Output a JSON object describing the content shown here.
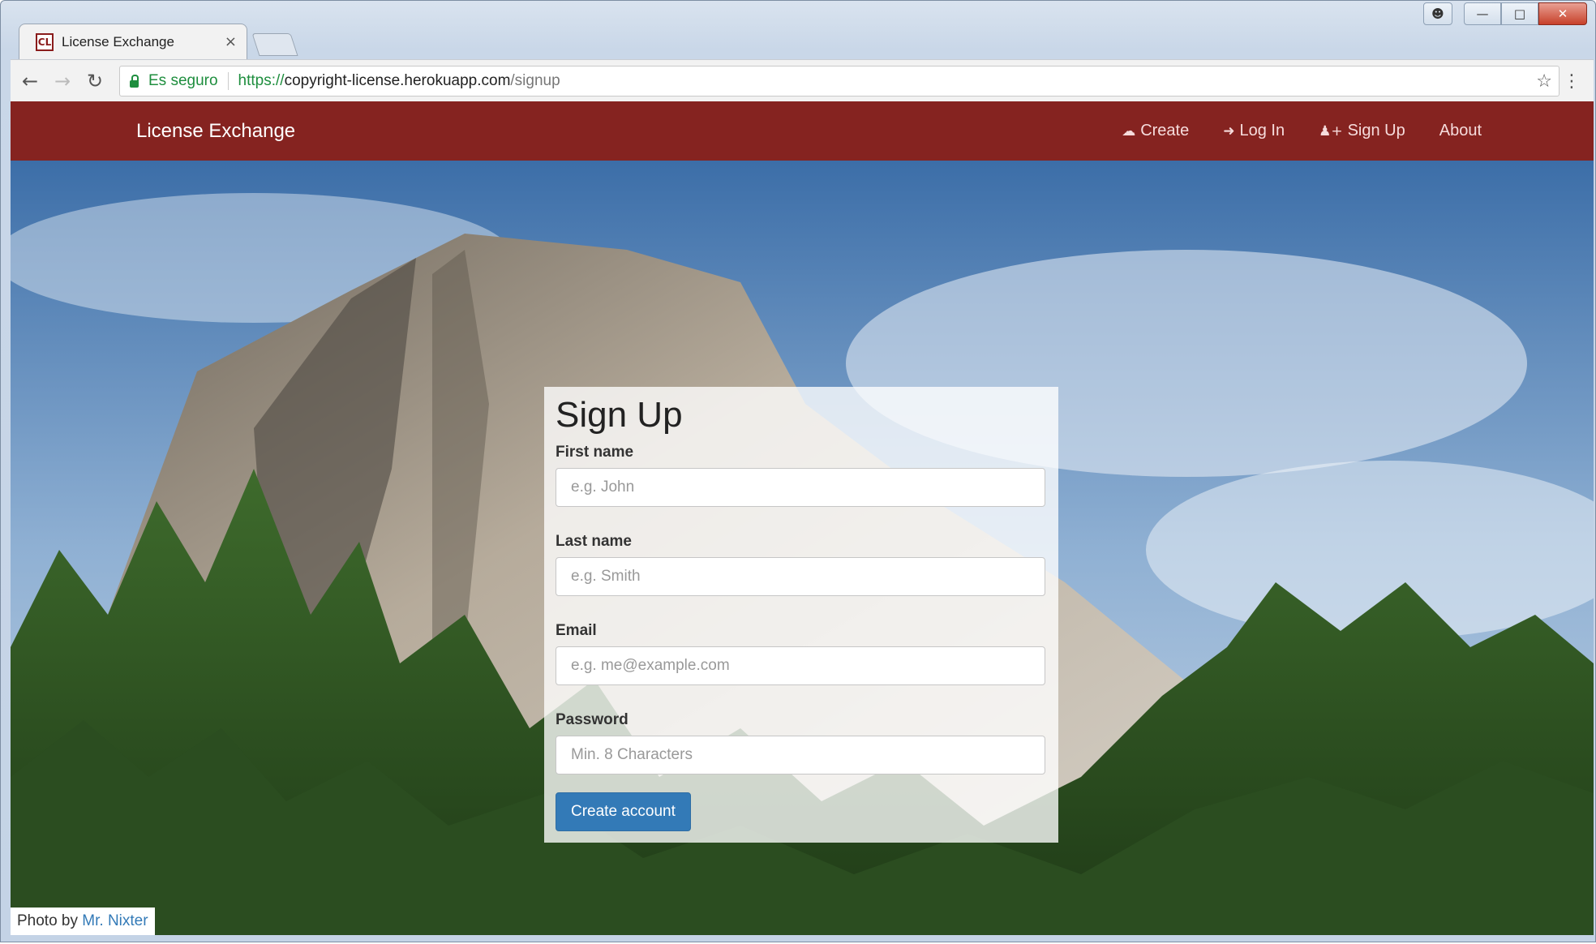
{
  "browser": {
    "tab_title": "License Exchange",
    "tab_close": "×",
    "favicon_text": "CL",
    "secure_label": "Es seguro",
    "url_scheme": "https://",
    "url_host": "copyright-license.herokuapp.com",
    "url_path": "/signup",
    "icons": [
      "back-icon",
      "forward-icon",
      "reload-icon",
      "lock-icon",
      "star-icon",
      "menu-icon"
    ]
  },
  "navbar": {
    "brand": "License Exchange",
    "bg_color": "#852320",
    "links": [
      {
        "label": "Create",
        "icon": "cloud-upload-icon"
      },
      {
        "label": "Log In",
        "icon": "log-in-icon"
      },
      {
        "label": "Sign Up",
        "icon": "user-add-icon"
      },
      {
        "label": "About",
        "icon": ""
      }
    ]
  },
  "form": {
    "title": "Sign Up",
    "fields": [
      {
        "label": "First name",
        "placeholder": "e.g. John"
      },
      {
        "label": "Last name",
        "placeholder": "e.g. Smith"
      },
      {
        "label": "Email",
        "placeholder": "e.g. me@example.com"
      },
      {
        "label": "Password",
        "placeholder": "Min. 8 Characters"
      }
    ],
    "submit": "Create account",
    "accent_color": "#337ab7"
  },
  "credit": {
    "prefix": "Photo by",
    "author": "Mr. Nixter"
  }
}
